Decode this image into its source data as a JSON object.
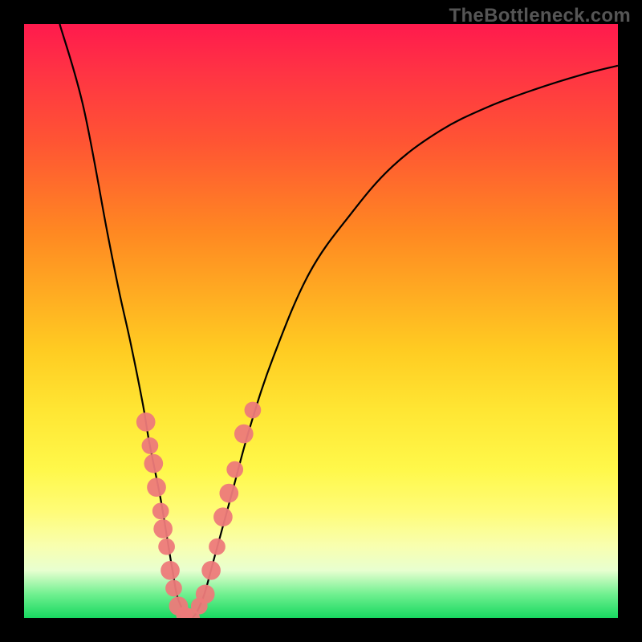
{
  "watermark": "TheBottleneck.com",
  "colors": {
    "top": "#ff1a4d",
    "mid": "#ffe633",
    "bottom": "#18d860",
    "curve": "#000000",
    "marker": "#ed7a7a",
    "frame": "#000000"
  },
  "chart_data": {
    "type": "line",
    "title": "",
    "xlabel": "",
    "ylabel": "",
    "xlim": [
      0,
      100
    ],
    "ylim": [
      0,
      100
    ],
    "x": [
      6,
      10,
      14,
      16,
      18,
      20,
      21,
      22,
      23,
      24,
      25,
      26,
      28,
      30,
      32,
      35,
      38,
      42,
      48,
      55,
      62,
      70,
      78,
      86,
      94,
      100
    ],
    "values": [
      100,
      86,
      65,
      55,
      46,
      36,
      30,
      25,
      20,
      14,
      8,
      3,
      0,
      3,
      10,
      21,
      32,
      44,
      58,
      68,
      76,
      82,
      86,
      89,
      91.5,
      93
    ],
    "series": [
      {
        "name": "bottleneck-curve",
        "x": [
          6,
          10,
          14,
          16,
          18,
          20,
          21,
          22,
          23,
          24,
          25,
          26,
          28,
          30,
          32,
          35,
          38,
          42,
          48,
          55,
          62,
          70,
          78,
          86,
          94,
          100
        ],
        "y": [
          100,
          86,
          65,
          55,
          46,
          36,
          30,
          25,
          20,
          14,
          8,
          3,
          0,
          3,
          10,
          21,
          32,
          44,
          58,
          68,
          76,
          82,
          86,
          89,
          91.5,
          93
        ]
      }
    ],
    "markers": [
      {
        "x": 20.5,
        "y": 33,
        "r": 1.6
      },
      {
        "x": 21.2,
        "y": 29,
        "r": 1.4
      },
      {
        "x": 21.8,
        "y": 26,
        "r": 1.6
      },
      {
        "x": 22.3,
        "y": 22,
        "r": 1.6
      },
      {
        "x": 23.0,
        "y": 18,
        "r": 1.4
      },
      {
        "x": 23.4,
        "y": 15,
        "r": 1.6
      },
      {
        "x": 24.0,
        "y": 12,
        "r": 1.4
      },
      {
        "x": 24.6,
        "y": 8,
        "r": 1.6
      },
      {
        "x": 25.2,
        "y": 5,
        "r": 1.4
      },
      {
        "x": 26.0,
        "y": 2,
        "r": 1.6
      },
      {
        "x": 27.0,
        "y": 0.5,
        "r": 1.4
      },
      {
        "x": 28.0,
        "y": 0,
        "r": 1.6
      },
      {
        "x": 29.5,
        "y": 2,
        "r": 1.4
      },
      {
        "x": 30.5,
        "y": 4,
        "r": 1.6
      },
      {
        "x": 31.5,
        "y": 8,
        "r": 1.6
      },
      {
        "x": 32.5,
        "y": 12,
        "r": 1.4
      },
      {
        "x": 33.5,
        "y": 17,
        "r": 1.6
      },
      {
        "x": 34.5,
        "y": 21,
        "r": 1.6
      },
      {
        "x": 35.5,
        "y": 25,
        "r": 1.4
      },
      {
        "x": 37.0,
        "y": 31,
        "r": 1.6
      },
      {
        "x": 38.5,
        "y": 35,
        "r": 1.4
      }
    ],
    "legend": false,
    "grid": false
  }
}
